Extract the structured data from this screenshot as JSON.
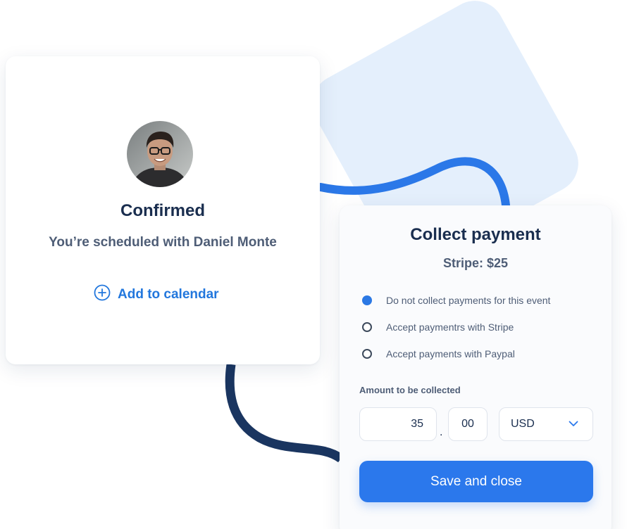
{
  "confirmation": {
    "title": "Confirmed",
    "subtitle": "You’re scheduled with Daniel Monte",
    "add_to_calendar_label": "Add to calendar"
  },
  "payment": {
    "title": "Collect payment",
    "subtitle": "Stripe: $25",
    "options": [
      {
        "label": "Do not collect payments for this event",
        "selected": true
      },
      {
        "label": "Accept paymentrs with Stripe",
        "selected": false
      },
      {
        "label": "Accept payments with Paypal",
        "selected": false
      }
    ],
    "amount_label": "Amount to be collected",
    "amount_whole": "35",
    "amount_separator": ".",
    "amount_cents": "00",
    "currency": "USD",
    "save_label": "Save and close"
  },
  "icons": {
    "add": "plus-circle-icon",
    "dropdown": "chevron-down-icon",
    "avatar": "person-photo"
  },
  "colors": {
    "accent": "#2b78ec",
    "heading": "#1a2e4f",
    "muted": "#4e5d76",
    "deco_blue_curve": "#2b78e8",
    "deco_navy_curve": "#1a3560",
    "deco_square": "#e4effc"
  }
}
